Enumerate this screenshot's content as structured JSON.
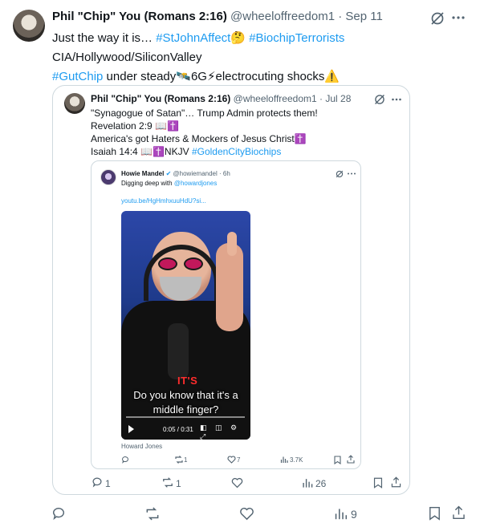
{
  "main": {
    "author_name": "Phil \"Chip\" You (Romans 2:16)",
    "handle": "@wheeloffreedom1",
    "date": "· Sep 11",
    "lines": [
      {
        "parts": [
          {
            "t": "Just the way it is… ",
            "c": ""
          },
          {
            "t": "#StJohnAffect",
            "c": "blue"
          },
          {
            "t": "🤔 ",
            "c": ""
          },
          {
            "t": "#BiochipTerrorists",
            "c": "blue"
          }
        ]
      },
      {
        "parts": [
          {
            "t": "CIA/Hollywood/SiliconValley",
            "c": ""
          }
        ]
      },
      {
        "parts": [
          {
            "t": "#GutChip",
            "c": "blue"
          },
          {
            "t": " under steady🛰️6G⚡electrocuting shocks⚠️",
            "c": ""
          }
        ]
      }
    ],
    "actions": {
      "replies": "",
      "reposts": "",
      "likes": "",
      "views": "9"
    }
  },
  "quote": {
    "author_name": "Phil \"Chip\" You (Romans 2:16)",
    "handle": "@wheeloffreedom1",
    "date": "· Jul 28",
    "lines": [
      "\"Synagogue of Satan\"… Trump Admin protects them!",
      "Revelation 2:9 📖✝️",
      "America's got Haters & Mockers of Jesus Christ✝️",
      "Isaiah 14:4 📖✝️NKJV "
    ],
    "hashtag": "#GoldenCityBiochips",
    "actions": {
      "replies": "1",
      "reposts": "1",
      "likes": "",
      "views": "26"
    }
  },
  "inner": {
    "author_name": "Howie Mandel",
    "handle": "@howiemandel · 6h",
    "text": "Digging deep with ",
    "mention": "@howardjones",
    "link": "youtu.be/HgHmhxuuHdU?si...",
    "video": {
      "caption_its": "IT'S",
      "caption_line1": "Do you know that it's a",
      "caption_line2": "middle finger?",
      "time": "0:05 / 0:31",
      "icons": "◧ ◫ ⚙ ⤢"
    },
    "credit": "Howard Jones",
    "actions": {
      "replies": "",
      "reposts": "1",
      "likes": "7",
      "views": "3.7K"
    }
  }
}
